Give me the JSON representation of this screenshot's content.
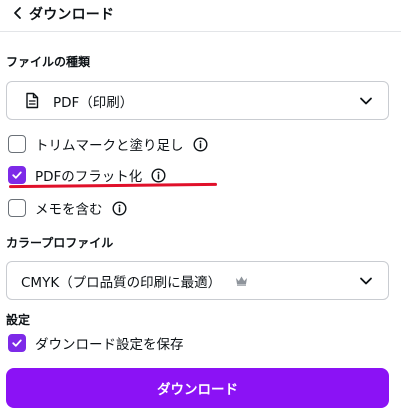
{
  "header": {
    "title": "ダウンロード",
    "back_icon": "chevron-left-icon"
  },
  "file_type": {
    "label": "ファイルの種類",
    "selected": "PDF（印刷）",
    "icon": "document-icon"
  },
  "options": [
    {
      "label": "トリムマークと塗り足し",
      "checked": false
    },
    {
      "label": "PDFのフラット化",
      "checked": true
    },
    {
      "label": "メモを含む",
      "checked": false
    }
  ],
  "color_profile": {
    "label": "カラープロファイル",
    "selected": "CMYK（プロ品質の印刷に最適）",
    "badge_icon": "crown-icon"
  },
  "settings": {
    "label": "設定",
    "save_label": "ダウンロード設定を保存",
    "save_checked": true
  },
  "download_button": {
    "label": "ダウンロード"
  },
  "colors": {
    "accent": "#8b12f5",
    "checkbox": "#7d2ae8",
    "annotation": "#e0102a"
  }
}
